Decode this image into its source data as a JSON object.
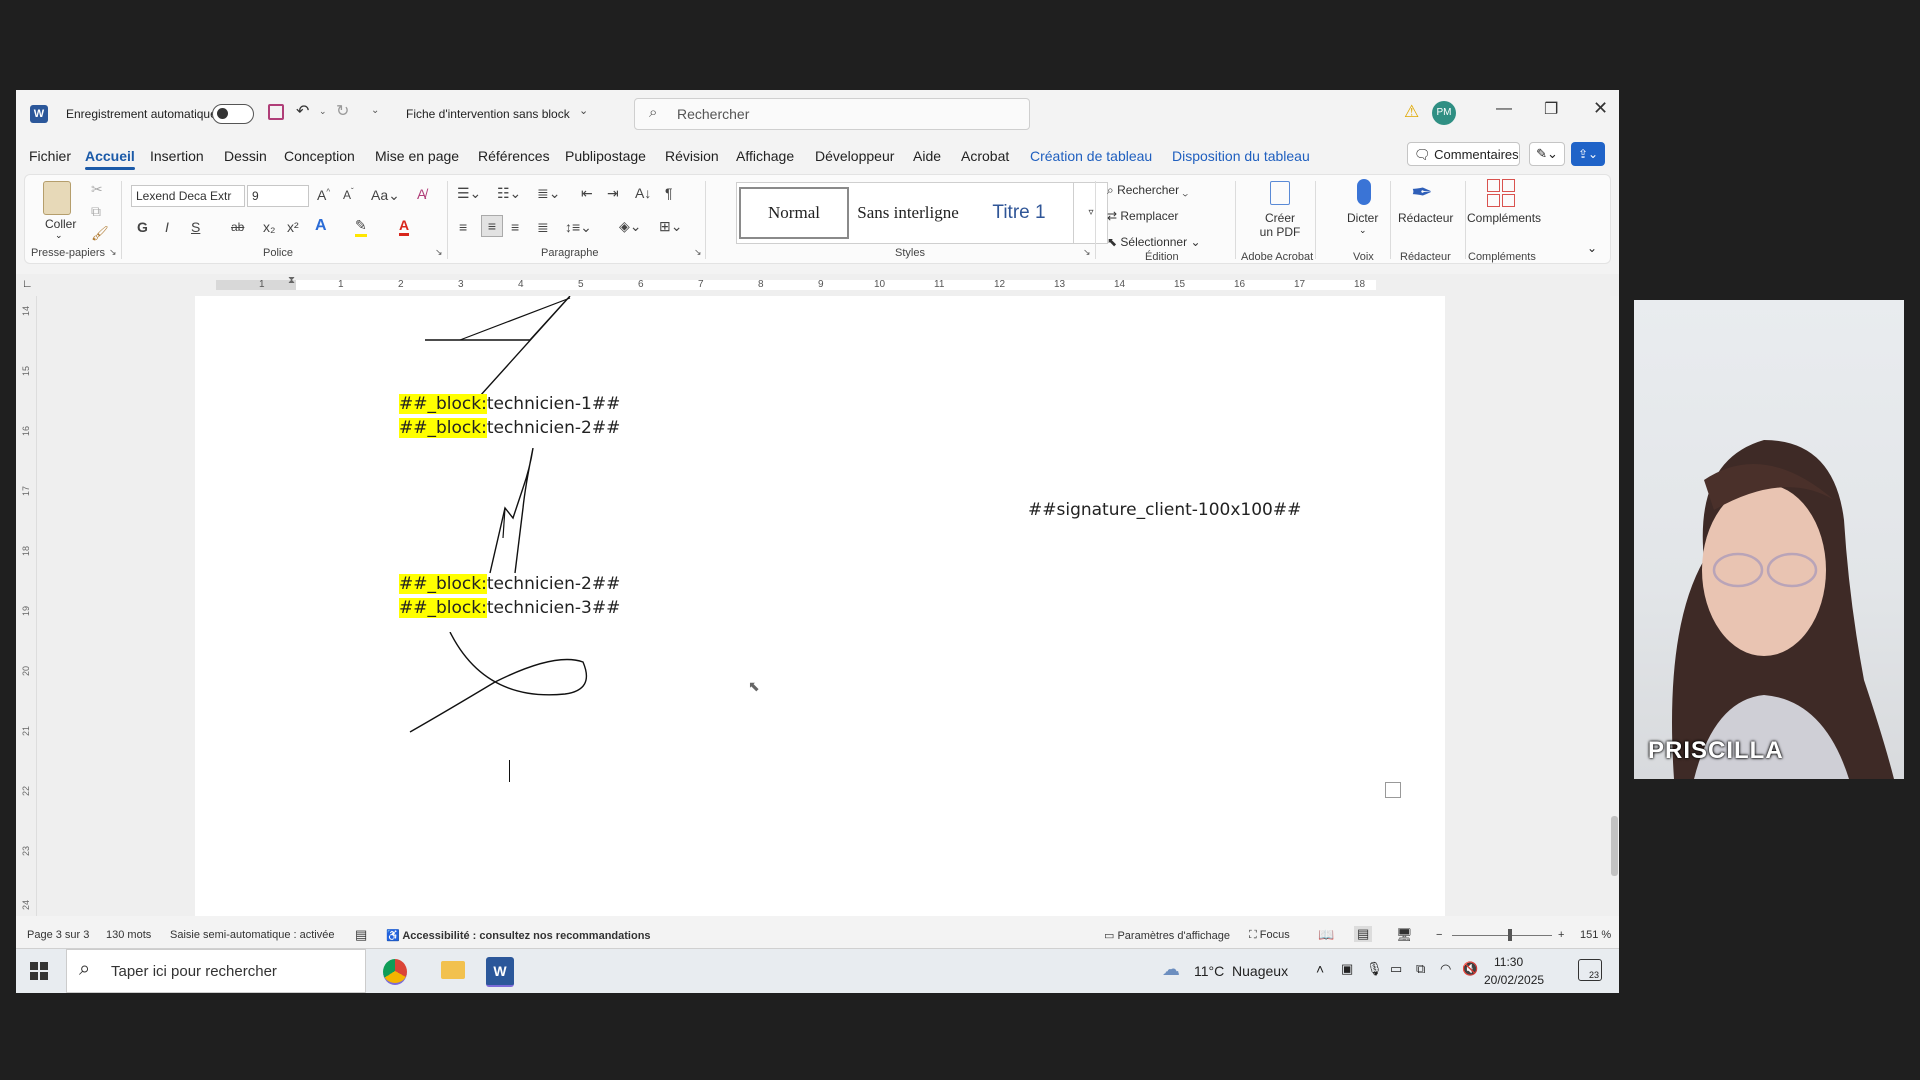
{
  "titlebar": {
    "autosave_label": "Enregistrement automatique",
    "doc_name": "Fiche d'intervention sans block",
    "search_placeholder": "Rechercher",
    "user_initials": "PM"
  },
  "menu": {
    "items": [
      "Fichier",
      "Accueil",
      "Insertion",
      "Dessin",
      "Conception",
      "Mise en page",
      "Références",
      "Publipostage",
      "Révision",
      "Affichage",
      "Développeur",
      "Aide",
      "Acrobat"
    ],
    "table_items": [
      "Création de tableau",
      "Disposition du tableau"
    ],
    "comments_label": "Commentaires"
  },
  "ribbon": {
    "clipboard": {
      "paste": "Coller",
      "label": "Presse-papiers"
    },
    "font": {
      "family": "Lexend Deca Extr",
      "size": "9",
      "label": "Police",
      "bold": "G",
      "italic": "I",
      "underline": "S",
      "strike": "ab"
    },
    "paragraph": {
      "label": "Paragraphe"
    },
    "styles": {
      "items": [
        "Normal",
        "Sans interligne",
        "Titre 1"
      ],
      "label": "Styles"
    },
    "editing": {
      "find": "Rechercher",
      "replace": "Remplacer",
      "select": "Sélectionner",
      "label": "Édition"
    },
    "acrobat": {
      "create_pdf_1": "Créer",
      "create_pdf_2": "un PDF",
      "label": "Adobe Acrobat"
    },
    "voice": {
      "dictate": "Dicter",
      "label": "Voix"
    },
    "editor": {
      "editor": "Rédacteur",
      "label": "Rédacteur"
    },
    "addins": {
      "addins": "Compléments",
      "label": "Compléments"
    }
  },
  "ruler": {
    "h_numbers": [
      "1",
      "1",
      "2",
      "3",
      "4",
      "5",
      "6",
      "7",
      "8",
      "9",
      "10",
      "11",
      "12",
      "13",
      "14",
      "15",
      "16",
      "17",
      "18"
    ],
    "v_numbers": [
      "14",
      "15",
      "16",
      "17",
      "18",
      "19",
      "20",
      "21",
      "22",
      "23",
      "24"
    ]
  },
  "document": {
    "block_prefix": "##_block:",
    "line1_rest": "technicien-1##",
    "line2_rest": "technicien-2##",
    "line3_rest": "technicien-2##",
    "line4_rest": "technicien-3##",
    "signature_tag": "##signature_client-100x100##"
  },
  "status": {
    "page": "Page 3 sur 3",
    "words": "130 mots",
    "autoinput": "Saisie semi-automatique : activée",
    "accessibility": "Accessibilité : consultez nos recommandations",
    "display_settings": "Paramètres d'affichage",
    "focus": "Focus",
    "zoom": "151 %"
  },
  "taskbar": {
    "search_placeholder": "Taper ici pour rechercher",
    "weather": "11°C  Nuageux",
    "time": "11:30",
    "date": "20/02/2025",
    "notif_count": "23"
  },
  "webcam": {
    "name": "PRISCILLA"
  }
}
